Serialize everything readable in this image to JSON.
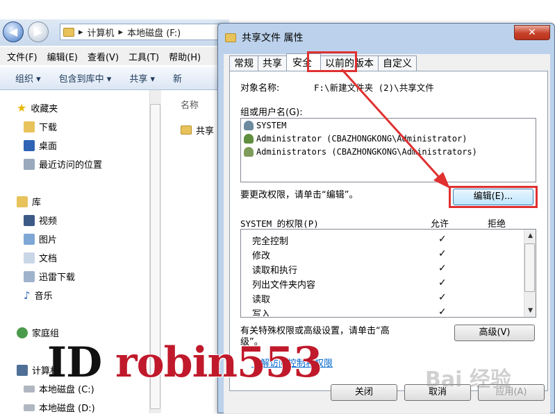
{
  "explorer": {
    "breadcrumb": [
      "计算机",
      "本地磁盘 (F:)"
    ],
    "menu": [
      "文件(F)",
      "编辑(E)",
      "查看(V)",
      "工具(T)",
      "帮助(H)"
    ],
    "commands": [
      "组织 ▾",
      "包含到库中 ▾",
      "共享 ▾",
      "新"
    ],
    "nav": {
      "favorites": "收藏夹",
      "favorite_items": [
        "下载",
        "桌面",
        "最近访问的位置"
      ],
      "libraries": "库",
      "library_items": [
        "视频",
        "图片",
        "文档",
        "迅雷下载",
        "音乐"
      ],
      "homegroup": "家庭组",
      "computer": "计算机",
      "drives": [
        "本地磁盘 (C:)",
        "本地磁盘 (D:)"
      ]
    },
    "column_header": "名称",
    "item": "共享"
  },
  "dialog": {
    "title": "共享文件 属性",
    "close_glyph": "✕",
    "tabs": [
      "常规",
      "共享",
      "安全",
      "以前的版本",
      "自定义"
    ],
    "active_tab": "安全",
    "object_label": "对象名称:",
    "object_value": "F:\\新建文件夹 (2)\\共享文件",
    "groups_label": "组或用户名(G):",
    "groups": [
      "SYSTEM",
      "Administrator (CBAZHONGKONG\\Administrator)",
      "Administrators (CBAZHONGKONG\\Administrators)"
    ],
    "edit_hint": "要更改权限，请单击“编辑”。",
    "edit_button": "编辑(E)...",
    "perm_header": "SYSTEM 的权限(P)",
    "allow_header": "允许",
    "deny_header": "拒绝",
    "permissions": [
      {
        "name": "完全控制",
        "allow": "✓"
      },
      {
        "name": "修改",
        "allow": "✓"
      },
      {
        "name": "读取和执行",
        "allow": "✓"
      },
      {
        "name": "列出文件夹内容",
        "allow": "✓"
      },
      {
        "name": "读取",
        "allow": "✓"
      },
      {
        "name": "写入",
        "allow": "✓"
      }
    ],
    "special_hint_1": "有关特殊权限或高级设置，请单击“高",
    "special_hint_2": "级”。",
    "advanced_button": "高级(V)",
    "learn_link": "了解访问控制和权限",
    "close_button": "关闭",
    "cancel_button": "取消",
    "apply_button": "应用(A)"
  },
  "watermark": {
    "id": "ID",
    "name": "robin553"
  },
  "baidu_mark": "Bai 经验",
  "colors": {
    "annotation_red": "#e03030",
    "window_frame": "#bcd2ec",
    "link": "#0066cc"
  }
}
